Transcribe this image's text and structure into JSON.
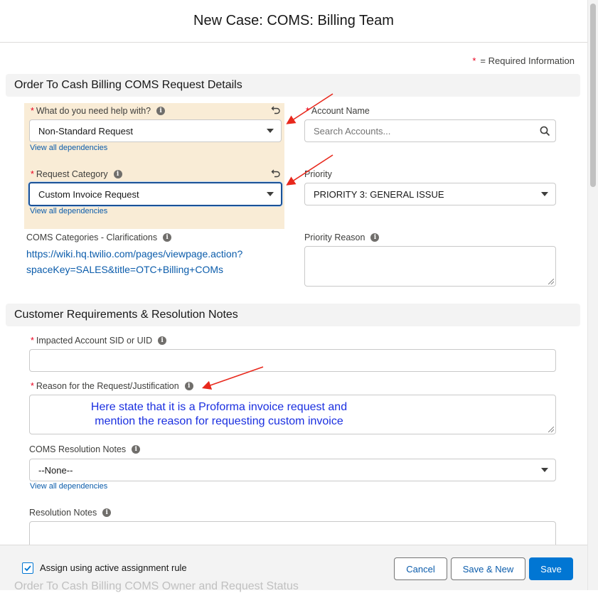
{
  "modal": {
    "title": "New Case: COMS: Billing Team"
  },
  "required_note": {
    "star": "*",
    "text": "= Required Information"
  },
  "sections": [
    {
      "label": "Order To Cash Billing COMS Request Details"
    },
    {
      "label": "Customer Requirements & Resolution Notes"
    }
  ],
  "fields": {
    "help_with": {
      "label": "What do you need help with?",
      "value": "Non-Standard Request",
      "link": "View all dependencies"
    },
    "account_name": {
      "label": "Account Name",
      "placeholder": "Search Accounts..."
    },
    "request_category": {
      "label": "Request Category",
      "value": "Custom Invoice Request",
      "link": "View all dependencies"
    },
    "priority": {
      "label": "Priority",
      "value": "PRIORITY 3: GENERAL ISSUE"
    },
    "coms_categories": {
      "label": "COMS Categories - Clarifications",
      "url_line1": "https://wiki.hq.twilio.com/pages/viewpage.action?",
      "url_line2": "spaceKey=SALES&title=OTC+Billing+COMs"
    },
    "priority_reason": {
      "label": "Priority Reason"
    },
    "impacted_sid": {
      "label": "Impacted Account SID or UID"
    },
    "reason": {
      "label": "Reason for the Request/Justification"
    },
    "coms_resolution_notes": {
      "label": "COMS Resolution Notes",
      "value": "--None--",
      "link": "View all dependencies"
    },
    "resolution_notes": {
      "label": "Resolution Notes"
    }
  },
  "annotation": {
    "line1": "Here state that it is a Proforma invoice request and",
    "line2": "mention the reason for requesting custom invoice",
    "color": "#1a2fe0"
  },
  "footer": {
    "assign_rule_label": "Assign using active assignment rule",
    "assign_rule_checked": true,
    "cancel": "Cancel",
    "save_new": "Save & New",
    "save": "Save",
    "behind_text": "Order To Cash Billing COMS Owner and Request Status"
  },
  "colors": {
    "accent": "#0176d3",
    "required": "#ea001e",
    "highlight": "#f9ecd6",
    "arrow": "#e8281c"
  },
  "icons": [
    "info-icon",
    "undo-icon",
    "search-icon",
    "chevron-down-icon",
    "check-icon"
  ]
}
